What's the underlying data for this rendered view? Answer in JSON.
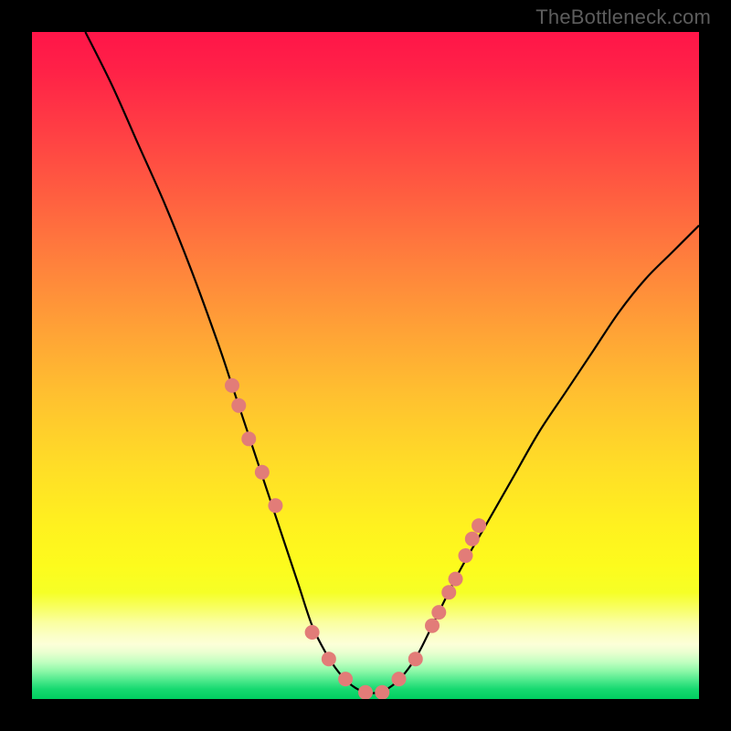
{
  "watermark": "TheBottleneck.com",
  "chart_data": {
    "type": "line",
    "title": "",
    "xlabel": "",
    "ylabel": "",
    "xlim": [
      0,
      100
    ],
    "ylim": [
      0,
      100
    ],
    "curve": {
      "x": [
        8,
        12,
        16,
        20,
        24,
        28,
        30,
        32,
        34,
        36,
        38,
        40,
        42,
        44,
        46,
        48,
        50,
        52,
        54,
        56,
        58,
        60,
        64,
        68,
        72,
        76,
        80,
        84,
        88,
        92,
        96,
        100
      ],
      "y": [
        100,
        92,
        83,
        74,
        64,
        53,
        47,
        41,
        35,
        29,
        23,
        17,
        11,
        7,
        4,
        2,
        1,
        1,
        2,
        4,
        7,
        11,
        19,
        26,
        33,
        40,
        46,
        52,
        58,
        63,
        67,
        71
      ]
    },
    "scatter": {
      "x": [
        30,
        31,
        32.5,
        34.5,
        36.5,
        42,
        44.5,
        47,
        50,
        52.5,
        55,
        57.5,
        60,
        61,
        62.5,
        63.5,
        65,
        66,
        67
      ],
      "y": [
        47,
        44,
        39,
        34,
        29,
        10,
        6,
        3,
        1,
        1,
        3,
        6,
        11,
        13,
        16,
        18,
        21.5,
        24,
        26
      ]
    },
    "gradient_stops": [
      {
        "offset": 0.0,
        "color": "#ff1549"
      },
      {
        "offset": 0.06,
        "color": "#ff2247"
      },
      {
        "offset": 0.15,
        "color": "#ff3f44"
      },
      {
        "offset": 0.25,
        "color": "#ff6040"
      },
      {
        "offset": 0.35,
        "color": "#ff823c"
      },
      {
        "offset": 0.45,
        "color": "#ffa336"
      },
      {
        "offset": 0.55,
        "color": "#ffc22f"
      },
      {
        "offset": 0.65,
        "color": "#ffdd27"
      },
      {
        "offset": 0.74,
        "color": "#fff11f"
      },
      {
        "offset": 0.8,
        "color": "#fdfb1d"
      },
      {
        "offset": 0.84,
        "color": "#f6ff26"
      },
      {
        "offset": 0.865,
        "color": "#f8ff67"
      },
      {
        "offset": 0.885,
        "color": "#faffa0"
      },
      {
        "offset": 0.905,
        "color": "#fbffc6"
      },
      {
        "offset": 0.918,
        "color": "#fcffd8"
      },
      {
        "offset": 0.93,
        "color": "#eaffd0"
      },
      {
        "offset": 0.945,
        "color": "#c0ffc0"
      },
      {
        "offset": 0.958,
        "color": "#8df8a8"
      },
      {
        "offset": 0.972,
        "color": "#4de98c"
      },
      {
        "offset": 0.985,
        "color": "#17d970"
      },
      {
        "offset": 1.0,
        "color": "#00cf60"
      }
    ],
    "curve_color": "#000000",
    "marker_color": "#e27c78",
    "marker_radius_px": 8
  }
}
